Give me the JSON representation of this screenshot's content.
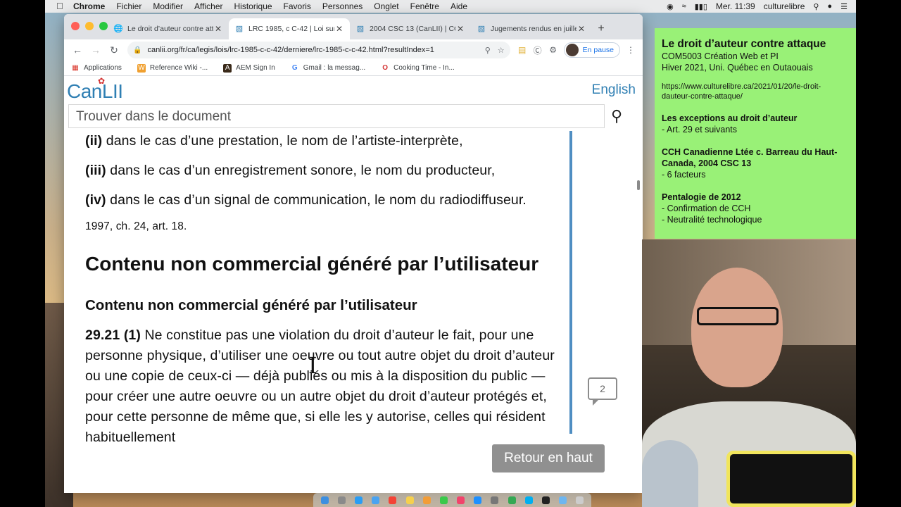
{
  "menubar": {
    "app": "Chrome",
    "items": [
      "Fichier",
      "Modifier",
      "Afficher",
      "Historique",
      "Favoris",
      "Personnes",
      "Onglet",
      "Fenêtre",
      "Aide"
    ],
    "clock": "Mer. 11:39",
    "user": "culturelibre"
  },
  "browser": {
    "tabs": [
      {
        "title": "Le droit d’auteur contre att",
        "icon": "globe-icon"
      },
      {
        "title": "LRC 1985, c C-42 | Loi sur",
        "icon": "canlii-icon"
      },
      {
        "title": "2004 CSC 13 (CanLII) | CC",
        "icon": "canlii-icon"
      },
      {
        "title": "Jugements rendus en juille",
        "icon": "canlii-icon"
      }
    ],
    "new_tab": "+",
    "url": "canlii.org/fr/ca/legis/lois/lrc-1985-c-c-42/derniere/lrc-1985-c-c-42.html?resultIndex=1",
    "profile_status": "En pause",
    "bookmarks": [
      {
        "label": "Applications",
        "icon": "apps-grid-icon"
      },
      {
        "label": "Reference Wiki -...",
        "icon": "wiki-icon"
      },
      {
        "label": "AEM Sign In",
        "icon": "aem-icon"
      },
      {
        "label": "Gmail : la messag...",
        "icon": "google-icon"
      },
      {
        "label": "Cooking Time - In...",
        "icon": "opera-icon"
      }
    ]
  },
  "canlii": {
    "logo": "CanLII",
    "language_link": "English",
    "search_placeholder": "Trouver dans le document",
    "lines": [
      {
        "num": "(ii)",
        "text": " dans le cas d’une prestation, le nom de l’artiste-interprète,"
      },
      {
        "num": "(iii)",
        "text": " dans le cas d’un enregistrement sonore, le nom du producteur,"
      },
      {
        "num": "(iv)",
        "text": " dans le cas d’un signal de communication, le nom du radiodiffuseur."
      }
    ],
    "citation": "1997, ch. 24, art. 18.",
    "heading": "Contenu non commercial généré par l’utilisateur",
    "subheading": "Contenu non commercial généré par l’utilisateur",
    "article_num": "29.21 (1)",
    "article_text": " Ne constitue pas une violation du droit d’auteur le fait, pour une personne physique, d’utiliser une oeuvre ou tout autre objet du droit d’auteur ou une copie de ceux-ci — déjà publiés ou mis à la disposition du public — pour créer une autre oeuvre ou un autre objet du droit d’auteur protégés et, pour cette personne de même que, si elle les y autorise, celles qui résident habituellement",
    "comment_count": "2",
    "back_to_top": "Retour en haut"
  },
  "note": {
    "title": "Le droit d’auteur contre attaque",
    "course": "COM5003 Création Web et PI",
    "term": "Hiver 2021, Uni. Québec en Outaouais",
    "url": "https://www.culturelibre.ca/2021/01/20/le-droit-dauteur-contre-attaque/",
    "sections": [
      {
        "heading": "Les exceptions au droit d’auteur",
        "items": [
          "- Art. 29 et suivants"
        ]
      },
      {
        "heading": "CCH Canadienne Ltée c. Barreau du Haut-Canada, 2004 CSC 13",
        "items": [
          "- 6 facteurs"
        ]
      },
      {
        "heading": "Pentalogie de 2012",
        "items": [
          "- Confirmation de CCH",
          "- Neutralité technologique"
        ]
      }
    ]
  },
  "colors": {
    "accent": "#2f7fb3",
    "note_bg": "#99f177",
    "scroll_line": "#4f8ec2"
  }
}
